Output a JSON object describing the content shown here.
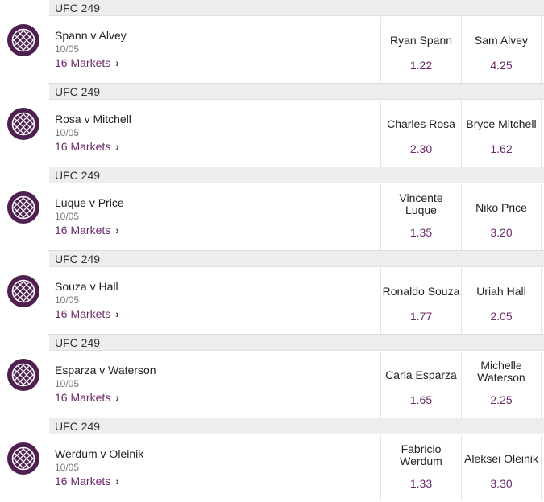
{
  "brand": {
    "accent": "#6b2a6b",
    "icon_bg": "#4f1f4f"
  },
  "events": [
    {
      "competition": "UFC 249",
      "title": "Spann v Alvey",
      "date": "10/05",
      "markets": "16 Markets",
      "home": {
        "name_lines": [
          "Ryan Spann"
        ],
        "price": "1.22"
      },
      "away": {
        "name_lines": [
          "Sam Alvey"
        ],
        "price": "4.25"
      }
    },
    {
      "competition": "UFC 249",
      "title": "Rosa v Mitchell",
      "date": "10/05",
      "markets": "16 Markets",
      "home": {
        "name_lines": [
          "Charles Rosa"
        ],
        "price": "2.30"
      },
      "away": {
        "name_lines": [
          "Bryce Mitchell"
        ],
        "price": "1.62"
      }
    },
    {
      "competition": "UFC 249",
      "title": "Luque v Price",
      "date": "10/05",
      "markets": "16 Markets",
      "home": {
        "name_lines": [
          "Vincente",
          "Luque"
        ],
        "price": "1.35"
      },
      "away": {
        "name_lines": [
          "Niko Price"
        ],
        "price": "3.20"
      }
    },
    {
      "competition": "UFC 249",
      "title": "Souza v Hall",
      "date": "10/05",
      "markets": "16 Markets",
      "home": {
        "name_lines": [
          "Ronaldo Souza"
        ],
        "price": "1.77"
      },
      "away": {
        "name_lines": [
          "Uriah Hall"
        ],
        "price": "2.05"
      }
    },
    {
      "competition": "UFC 249",
      "title": "Esparza v Waterson",
      "date": "10/05",
      "markets": "16 Markets",
      "home": {
        "name_lines": [
          "Carla Esparza"
        ],
        "price": "1.65"
      },
      "away": {
        "name_lines": [
          "Michelle",
          "Waterson"
        ],
        "price": "2.25"
      }
    },
    {
      "competition": "UFC 249",
      "title": "Werdum v Oleinik",
      "date": "10/05",
      "markets": "16 Markets",
      "home": {
        "name_lines": [
          "Fabricio",
          "Werdum"
        ],
        "price": "1.33"
      },
      "away": {
        "name_lines": [
          "Aleksei Oleinik"
        ],
        "price": "3.30"
      }
    }
  ]
}
